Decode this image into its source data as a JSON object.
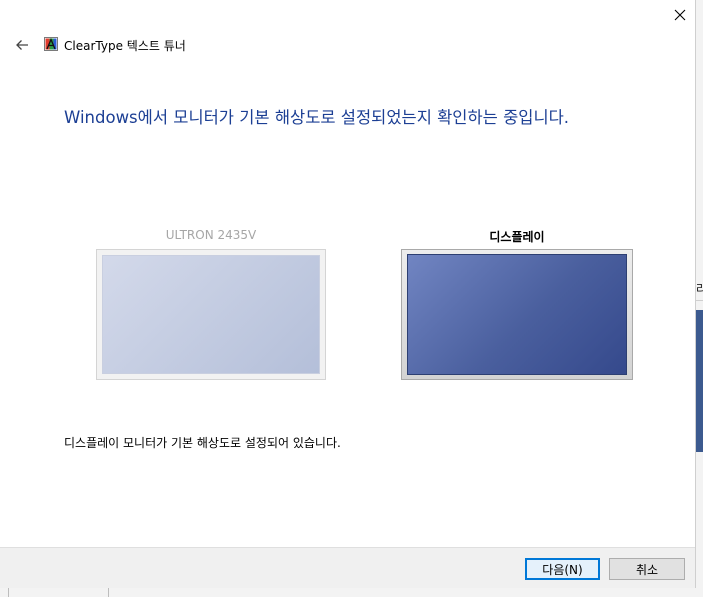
{
  "window": {
    "title": "ClearType 텍스트 튜너",
    "close_icon": "close-icon",
    "back_icon": "back-arrow-icon",
    "app_icon": "cleartype-app-icon"
  },
  "main": {
    "headline": "Windows에서 모니터가 기본 해상도로 설정되었는지 확인하는 중입니다.",
    "monitors": [
      {
        "label": "ULTRON 2435V",
        "selected": false
      },
      {
        "label": "디스플레이",
        "selected": true
      }
    ],
    "status": "디스플레이 모니터가 기본 해상도로 설정되어 있습니다."
  },
  "footer": {
    "next_label": "다음(N)",
    "cancel_label": "취소"
  },
  "background": {
    "partial_text": "라"
  },
  "colors": {
    "headline": "#1c3f94",
    "accent": "#0078d7",
    "monitor_selected": "#4a5f9e",
    "monitor_inactive": "#c3cbe2"
  }
}
